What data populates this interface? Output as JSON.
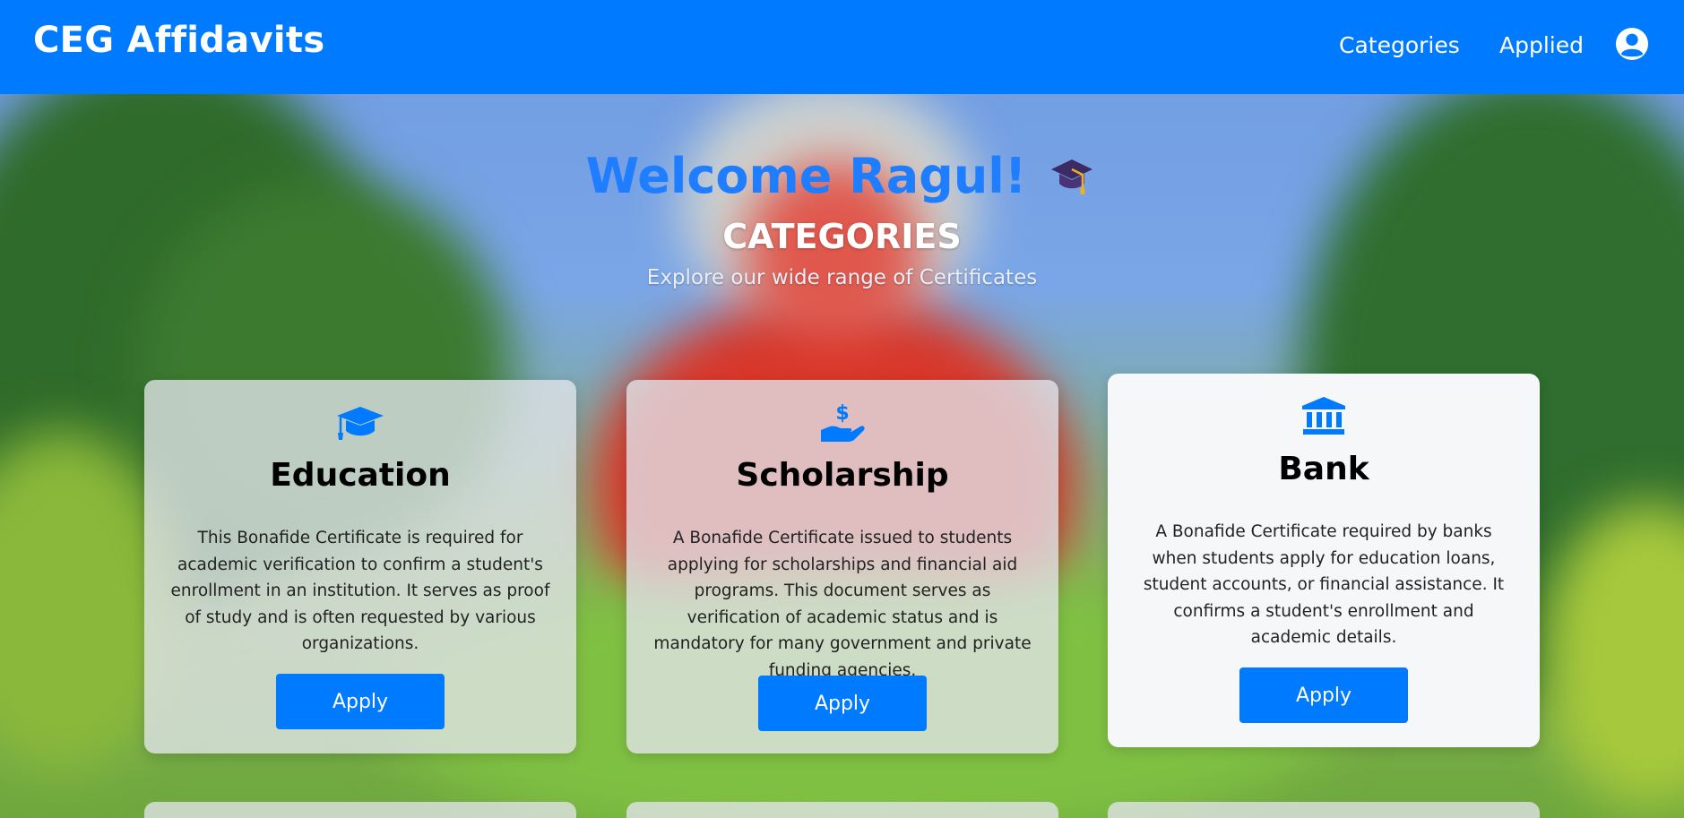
{
  "navbar": {
    "brand": "CEG Affidavits",
    "links": [
      {
        "label": "Categories"
      },
      {
        "label": "Applied"
      }
    ],
    "user_icon": "user-circle-icon",
    "color": "#007bff"
  },
  "hero": {
    "welcome": "Welcome Ragul!",
    "welcome_icon": "graduation-cap-emoji-icon",
    "title": "CATEGORIES",
    "subtitle": "Explore our wide range of Certificates"
  },
  "cards": [
    {
      "icon": "graduation-cap-icon",
      "title": "Education",
      "description": "This Bonafide Certificate is required for academic verification to confirm a student's enrollment in an institution. It serves as proof of study and is often requested by various organizations.",
      "button": "Apply"
    },
    {
      "icon": "hand-holding-dollar-icon",
      "title": "Scholarship",
      "description": "A Bonafide Certificate issued to students applying for scholarships and financial aid programs. This document serves as verification of academic status and is mandatory for many government and private funding agencies.",
      "button": "Apply"
    },
    {
      "icon": "bank-building-icon",
      "title": "Bank",
      "description": "A Bonafide Certificate required by banks when students apply for education loans, student accounts, or financial assistance. It confirms a student's enrollment and academic details.",
      "button": "Apply"
    }
  ],
  "colors": {
    "accent": "#007bff",
    "welcome_text": "#1f7dff"
  }
}
